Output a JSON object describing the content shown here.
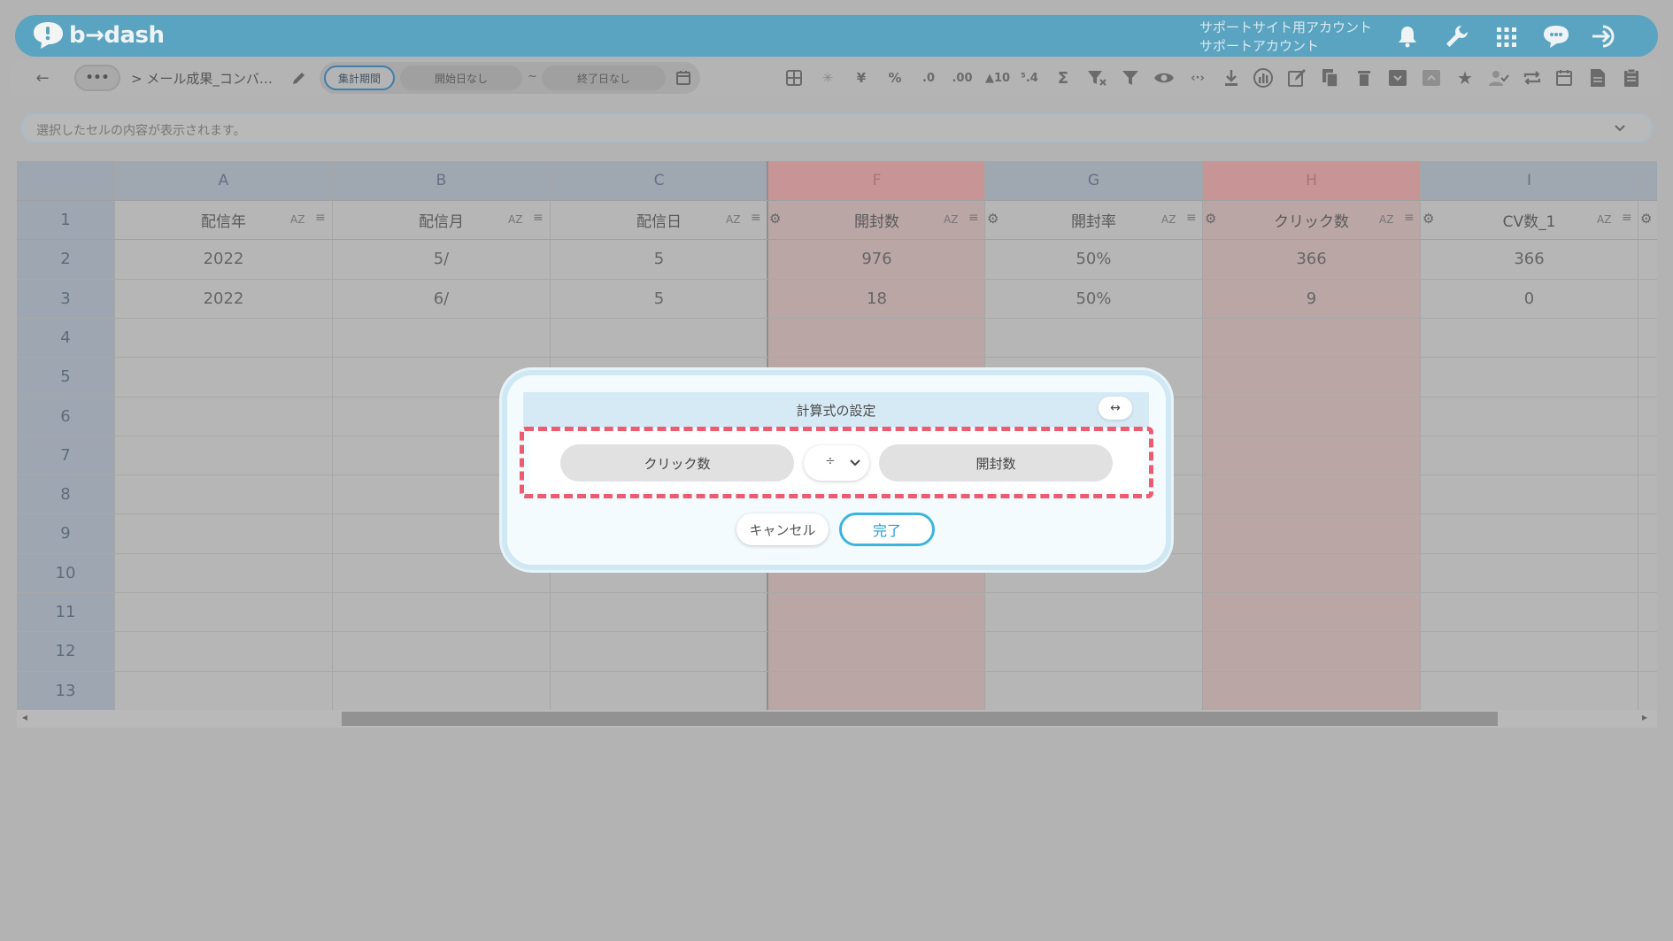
{
  "app": {
    "logo_text": "b→dash",
    "account_site": "サポートサイト用アカウント",
    "account_user": "サポートアカウント"
  },
  "toolbar": {
    "back_icon": "arrow-left-icon",
    "more_label": "•••",
    "breadcrumb": "> メール成果_コンバ…",
    "period_label": "集計期間",
    "start_date": "開始日なし",
    "tilde": "~",
    "end_date": "終了日なし",
    "icons": [
      "table-icon",
      "loading-icon",
      "yen-icon",
      "percent-icon",
      "decimal-decrease-icon",
      "decimal-increase-icon",
      "number-format-icon",
      "scale-icon",
      "sigma-icon",
      "filter-clear-icon",
      "filter-icon",
      "eye-icon",
      "code-icon",
      "download-icon",
      "chart-icon",
      "edit-icon",
      "copy-icon",
      "trash-icon",
      "archive-icon",
      "archive-disabled-icon",
      "star-icon",
      "user-check-icon",
      "repeat-icon",
      "calendar-icon",
      "document-icon",
      "clipboard-icon"
    ],
    "text_icons": {
      "yen": "¥",
      "percent": "%",
      "dec_dec": ".0",
      "dec_inc": ".00",
      "num_fmt": "▲10",
      "scale": "⁵.4",
      "sigma": "Σ"
    }
  },
  "formula_bar": {
    "placeholder": "選択したセルの内容が表示されます。"
  },
  "sheet": {
    "columns": [
      {
        "letter": "A",
        "field": "配信年",
        "highlight": false
      },
      {
        "letter": "B",
        "field": "配信月",
        "highlight": false
      },
      {
        "letter": "C",
        "field": "配信日",
        "highlight": false
      },
      {
        "letter": "F",
        "field": "開封数",
        "highlight": true
      },
      {
        "letter": "G",
        "field": "開封率",
        "highlight": false
      },
      {
        "letter": "H",
        "field": "クリック数",
        "highlight": true
      },
      {
        "letter": "I",
        "field": "CV数_1",
        "highlight": false
      }
    ],
    "sort_label": "AZ",
    "row_numbers": [
      "1",
      "2",
      "3",
      "4",
      "5",
      "6",
      "7",
      "8",
      "9",
      "10",
      "11",
      "12",
      "13"
    ],
    "rows": [
      [
        "2022",
        "5/",
        "5",
        "976",
        "50%",
        "366",
        "366"
      ],
      [
        "2022",
        "6/",
        "5",
        "18",
        "50%",
        "9",
        "0"
      ]
    ]
  },
  "dialog": {
    "title": "計算式の設定",
    "swap_icon": "↔",
    "left_operand": "クリック数",
    "operator": "÷",
    "right_operand": "開封数",
    "cancel_label": "キャンセル",
    "done_label": "完了"
  },
  "colors": {
    "accent": "#3ab4dd",
    "highlight_dashed": "#ef5b6e",
    "top_bar": "#5aa4c2"
  }
}
